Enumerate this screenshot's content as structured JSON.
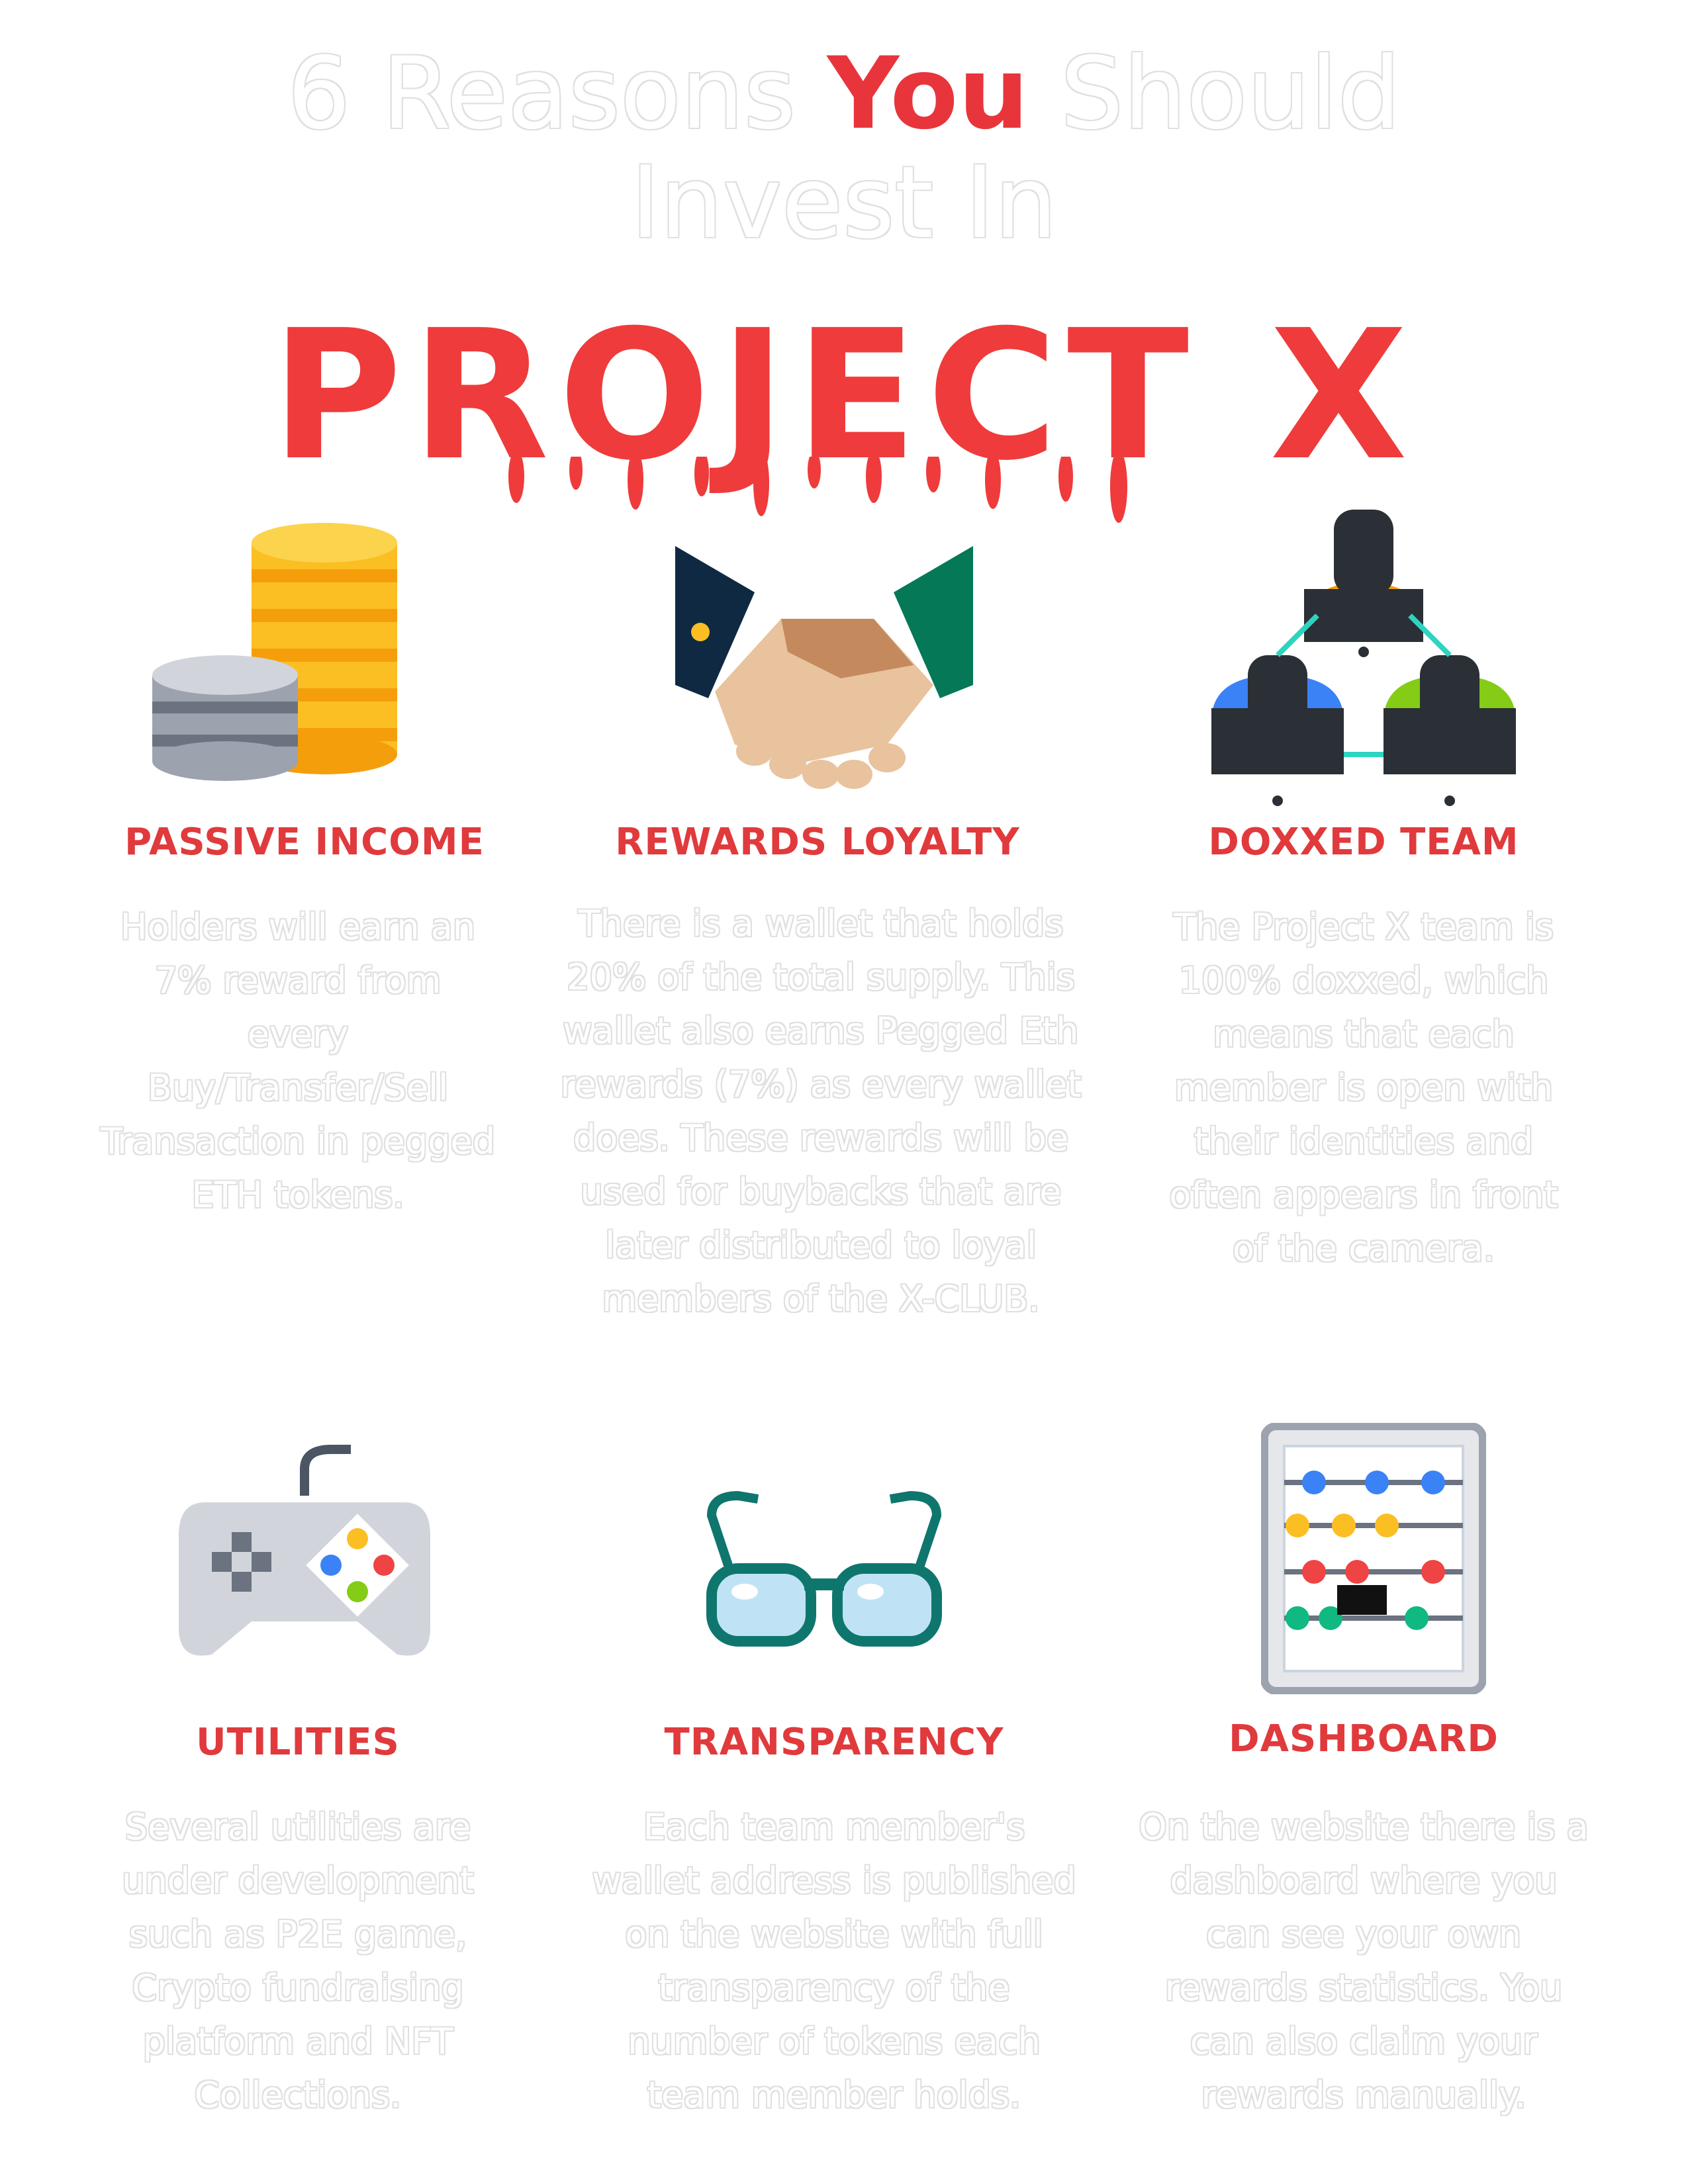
{
  "headline": {
    "part1": "6 Reasons ",
    "accent": "You",
    "part2": " Should",
    "line2": "Invest In"
  },
  "brand": "PROJECT X",
  "colors": {
    "accent": "#e8353b",
    "outline": "#e0e0e0"
  },
  "features": [
    {
      "icon": "coins-icon",
      "title": "PASSIVE INCOME",
      "body": "Holders will earn an 7% reward from every Buy/Transfer/Sell Transaction in pegged ETH tokens."
    },
    {
      "icon": "handshake-icon",
      "title": "REWARDS LOYALTY",
      "body": "There is a wallet that holds 20% of the total supply. This wallet also earns Pegged Eth rewards (7%) as every wallet does. These rewards will be used for buybacks that are later distributed to loyal members of the X-CLUB."
    },
    {
      "icon": "team-icon",
      "title": "DOXXED TEAM",
      "body": "The Project X team is 100% doxxed, which means that each member is open with their identities and often appears in front of the camera."
    },
    {
      "icon": "gamepad-icon",
      "title": "UTILITIES",
      "body": "Several utilities are under development such as P2E game, Crypto fundraising platform and NFT Collections."
    },
    {
      "icon": "glasses-icon",
      "title": "TRANSPARENCY",
      "body": "Each team member's wallet address is published on the website with full transparency of the number of tokens each team member holds."
    },
    {
      "icon": "abacus-icon",
      "title": "DASHBOARD",
      "body": "On the website there is a dashboard where you can see your own rewards statistics. You can also claim your rewards manually."
    }
  ]
}
